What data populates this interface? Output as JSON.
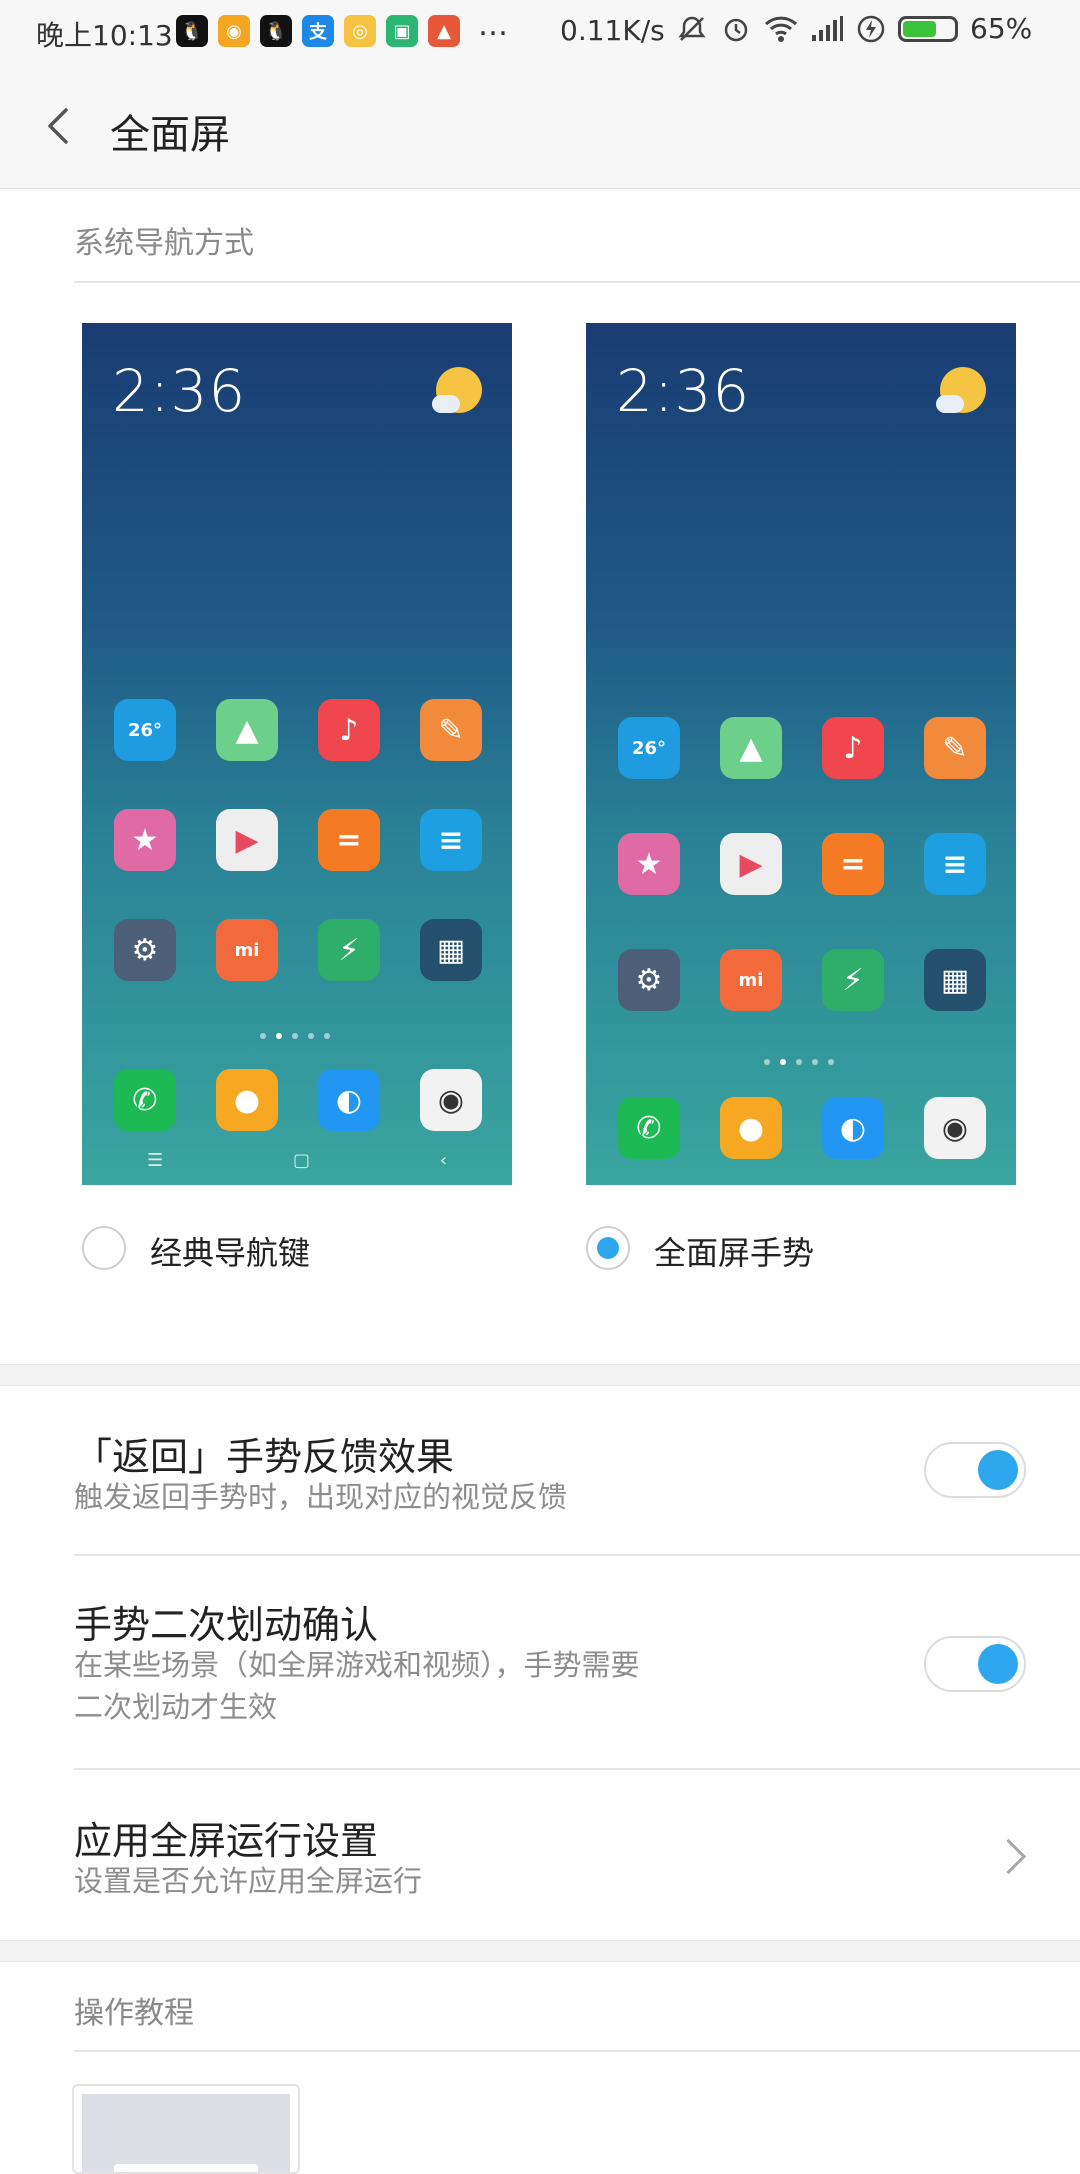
{
  "status_bar": {
    "time": "晚上10:13",
    "more": "…",
    "speed": "0.11K/s",
    "battery_percent": "65%",
    "battery_level": 0.65,
    "app_icons": [
      {
        "name": "qq-icon",
        "color": "#111111",
        "glyph": "🐧"
      },
      {
        "name": "pill-app-icon",
        "color": "#f5a623",
        "glyph": "◉"
      },
      {
        "name": "qq-icon",
        "color": "#111111",
        "glyph": "🐧"
      },
      {
        "name": "alipay-icon",
        "color": "#1e88e5",
        "glyph": "支"
      },
      {
        "name": "weibo-icon",
        "color": "#f5c242",
        "glyph": "◎"
      },
      {
        "name": "shield-app-icon",
        "color": "#2bb673",
        "glyph": "▣"
      },
      {
        "name": "fox-app-icon",
        "color": "#e5583a",
        "glyph": "▲"
      }
    ]
  },
  "header": {
    "title": "全面屏"
  },
  "nav_section": {
    "label": "系统导航方式",
    "options": [
      {
        "label": "经典导航键",
        "selected": false
      },
      {
        "label": "全面屏手势",
        "selected": true
      }
    ]
  },
  "preview": {
    "time": "2:36",
    "weather_icon": "partly-sunny-icon",
    "apps": [
      {
        "name": "weather-app-icon",
        "color": "#1f9be0",
        "glyph": "26°"
      },
      {
        "name": "gallery-app-icon",
        "color": "#6ccf8a",
        "glyph": "▲"
      },
      {
        "name": "music-app-icon",
        "color": "#f0464e",
        "glyph": "♪"
      },
      {
        "name": "themes-app-icon",
        "color": "#f28a3b",
        "glyph": "✎"
      },
      {
        "name": "favorites-app-icon",
        "color": "#e06aa4",
        "glyph": "★"
      },
      {
        "name": "video-app-icon",
        "color": "#eeeeee",
        "glyph": "▶"
      },
      {
        "name": "calculator-app-icon",
        "color": "#f57a24",
        "glyph": "="
      },
      {
        "name": "notes-app-icon",
        "color": "#1e9fe0",
        "glyph": "≡"
      },
      {
        "name": "settings-app-icon",
        "color": "#4d5e78",
        "glyph": "⚙"
      },
      {
        "name": "mi-store-app-icon",
        "color": "#f26a3c",
        "glyph": "mi"
      },
      {
        "name": "security-app-icon",
        "color": "#2fae6a",
        "glyph": "⚡"
      },
      {
        "name": "folder-app-icon",
        "color": "#24506e",
        "glyph": "▦"
      }
    ],
    "dock": [
      {
        "name": "phone-app-icon",
        "color": "#1db954",
        "glyph": "✆"
      },
      {
        "name": "messages-app-icon",
        "color": "#f7a823",
        "glyph": "●"
      },
      {
        "name": "browser-app-icon",
        "color": "#2196f3",
        "glyph": "◐"
      },
      {
        "name": "camera-app-icon",
        "color": "#f2f2f2",
        "glyph": "◉"
      }
    ],
    "nav_keys": [
      "☰",
      "▢",
      "‹"
    ]
  },
  "settings": [
    {
      "title": "「返回」手势反馈效果",
      "subtitle": "触发返回手势时，出现对应的视觉反馈",
      "control": "toggle",
      "enabled": true
    },
    {
      "title": "手势二次划动确认",
      "subtitle_line1": "在某些场景（如全屏游戏和视频），手势需要",
      "subtitle_line2": "二次划动才生效",
      "control": "toggle",
      "enabled": true
    },
    {
      "title": "应用全屏运行设置",
      "subtitle": "设置是否允许应用全屏运行",
      "control": "chevron"
    }
  ],
  "tutorial_section": {
    "label": "操作教程"
  },
  "colors": {
    "accent": "#2ea7ef",
    "battery": "#3cc13a"
  }
}
